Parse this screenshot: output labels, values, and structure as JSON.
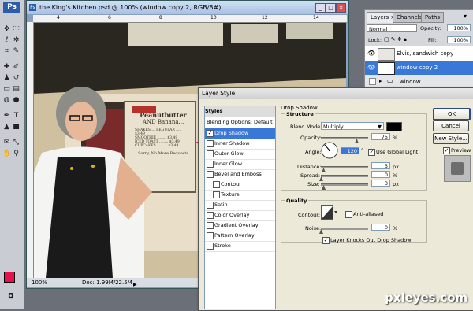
{
  "document": {
    "title": "the King's Kitchen.psd @ 100% (window copy 2, RGB/8#)",
    "zoom": "100%",
    "doc_size": "Doc: 1.99M/22.5M",
    "ruler_top": [
      "4",
      "6",
      "8",
      "10",
      "12",
      "14"
    ],
    "sign_lines": [
      "Peanutbutter",
      "AND Banana...",
      "SHAKES ... REGULAR .... $3.49",
      "SMOOTHIE ........ $3.49",
      "ICED TOAST ........ $3.49",
      "CUPCAKES ......... $3.49",
      "Sorry, No More Requests"
    ]
  },
  "tools": {
    "app_badge": "Ps"
  },
  "layers_panel": {
    "tabs": [
      "Layers ×",
      "Channels",
      "Paths"
    ],
    "blend_mode": "Normal",
    "opacity_label": "Opacity:",
    "opacity_value": "100%",
    "lock_label": "Lock:",
    "fill_label": "Fill:",
    "fill_value": "100%",
    "layers": [
      {
        "name": "Elvis, sandwich copy",
        "selected": false
      },
      {
        "name": "window copy 2",
        "selected": true
      },
      {
        "name": "window",
        "selected": false
      }
    ]
  },
  "layer_style": {
    "title": "Layer Style",
    "styles_header": "Styles",
    "blending_options": "Blending Options: Default",
    "items": [
      {
        "label": "Drop Shadow",
        "checked": true,
        "active": true
      },
      {
        "label": "Inner Shadow",
        "checked": false
      },
      {
        "label": "Outer Glow",
        "checked": false
      },
      {
        "label": "Inner Glow",
        "checked": false
      },
      {
        "label": "Bevel and Emboss",
        "checked": false
      },
      {
        "label": "Contour",
        "checked": false,
        "indent": true
      },
      {
        "label": "Texture",
        "checked": false,
        "indent": true
      },
      {
        "label": "Satin",
        "checked": false
      },
      {
        "label": "Color Overlay",
        "checked": false
      },
      {
        "label": "Gradient Overlay",
        "checked": false
      },
      {
        "label": "Pattern Overlay",
        "checked": false
      },
      {
        "label": "Stroke",
        "checked": false
      }
    ],
    "section_title": "Drop Shadow",
    "structure_title": "Structure",
    "blend_mode_label": "Blend Mode:",
    "blend_mode_value": "Multiply",
    "shadow_color": "#000000",
    "opacity_label": "Opacity:",
    "opacity_value": "75",
    "angle_label": "Angle:",
    "angle_value": "120",
    "global_light_label": "Use Global Light",
    "distance_label": "Distance:",
    "distance_value": "3",
    "spread_label": "Spread:",
    "spread_value": "0",
    "size_label": "Size:",
    "size_value": "3",
    "unit_px": "px",
    "unit_pct": "%",
    "unit_deg": "°",
    "quality_title": "Quality",
    "contour_label": "Contour:",
    "antialiased_label": "Anti-aliased",
    "noise_label": "Noise:",
    "noise_value": "0",
    "knockout_label": "Layer Knocks Out Drop Shadow",
    "ok_label": "OK",
    "cancel_label": "Cancel",
    "new_style_label": "New Style...",
    "preview_label": "Preview"
  },
  "watermark": "pxleyes.com",
  "colors": {
    "accent_selection": "#3a78d8",
    "foreground_swatch": "#e8104f"
  }
}
